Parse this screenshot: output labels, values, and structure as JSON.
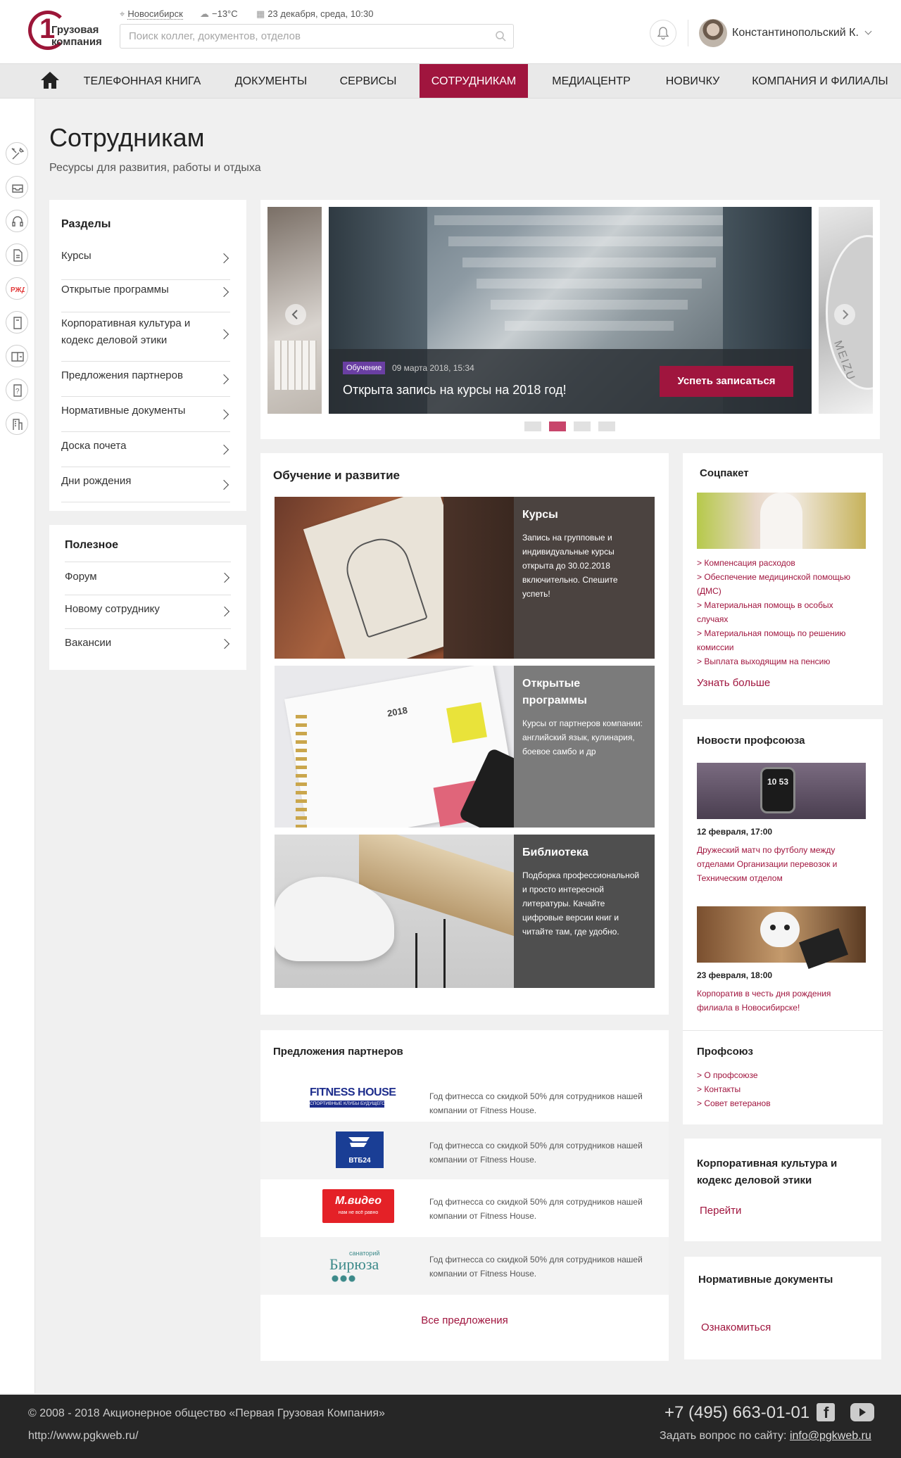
{
  "header": {
    "logo_line1": "Грузовая",
    "logo_line2": "компания",
    "city": "Новосибирск",
    "weather": "−13°C",
    "date": "23 декабря, среда, 10:30",
    "search_placeholder": "Поиск коллег, документов, отделов",
    "user_name": "Константинопольский К."
  },
  "nav": {
    "items": [
      "Телефонная книга",
      "Документы",
      "Сервисы",
      "Сотрудникам",
      "Медиацентр",
      "Новичку",
      "Компания и филиалы"
    ],
    "active_index": 3
  },
  "page": {
    "title": "Сотрудникам",
    "subtitle": "Ресурсы для развития, работы и отдыха"
  },
  "sections": {
    "heading": "Разделы",
    "items": [
      "Курсы",
      "Открытые программы",
      "Корпоративная культура и кодекс деловой этики",
      "Предложения партнеров",
      "Нормативные документы",
      "Доска почета",
      "Дни рождения"
    ]
  },
  "useful": {
    "heading": "Полезное",
    "items": [
      "Форум",
      "Новому сотруднику",
      "Вакансии"
    ]
  },
  "slider": {
    "tag": "Обучение",
    "date": "09 марта 2018, 15:34",
    "title": "Открыта запись на курсы на 2018 год!",
    "button": "Успеть записаться",
    "active_dot": 1,
    "dots_count": 4,
    "side_brand": "MEIZU"
  },
  "learning": {
    "heading": "Обучение и развитие",
    "cards": [
      {
        "title": "Курсы",
        "text": "Запись на групповые и индивидуальные курсы открыта до 30.02.2018 включительно. Спешите успеть!"
      },
      {
        "title": "Открытые программы",
        "text": "Курсы от партнеров компании: английский язык, кулинария, боевое самбо и др"
      },
      {
        "title": "Библиотека",
        "text": "Подборка профессиональной и просто интересной литературы. Качайте цифровые версии книг и читайте там, где удобно."
      }
    ],
    "calendar_year": "2018"
  },
  "partners": {
    "heading": "Предложения партнеров",
    "rows": [
      {
        "brand": "FITNESS HOUSE",
        "brand_sub": "СПОРТИВНЫЕ КЛУБЫ БУДУЩЕГО",
        "text": "Год фитнесса со скидкой 50% для сотрудников нашей компании от Fitness House."
      },
      {
        "brand": "ВТБ24",
        "brand_sub": "",
        "text": "Год фитнесса со скидкой 50% для сотрудников нашей компании от Fitness House."
      },
      {
        "brand": "М.видео",
        "brand_sub": "нам не всё равно",
        "text": "Год фитнесса со скидкой 50% для сотрудников нашей компании от Fitness House."
      },
      {
        "brand": "Бирюза",
        "brand_sub": "санаторий",
        "text": "Год фитнесса со скидкой 50% для сотрудников нашей компании от Fitness House."
      }
    ],
    "all_link": "Все предложения"
  },
  "social": {
    "heading": "Соцпакет",
    "links": [
      "> Компенсация расходов",
      "> Обеспечение медицинской помощью (ДМС)",
      "> Материальная помощь в особых случаях",
      "> Материальная помощь по решению комиссии",
      "> Выплата выходящим на пенсию"
    ],
    "more": "Узнать больше"
  },
  "union_news": {
    "heading": "Новости профсоюза",
    "items": [
      {
        "date": "12 февраля, 17:00",
        "title": "Дружеский матч по футболу между отделами Организации перевозок и Техническим отделом",
        "watch_digits": "10 53"
      },
      {
        "date": "23 февраля, 18:00",
        "title": "Корпоратив в честь дня рождения филиала в Новосибирске!"
      }
    ]
  },
  "union": {
    "heading": "Профсоюз",
    "links": [
      "> О профсоюзе",
      "> Контакты",
      "> Совет ветеранов"
    ]
  },
  "culture": {
    "heading": "Корпоративная культура и кодекс деловой этики",
    "link": "Перейти"
  },
  "norms": {
    "heading": "Нормативные документы",
    "link": "Ознакомиться"
  },
  "footer": {
    "copyright": "© 2008 - 2018 Акционерное общество «Первая Грузовая Компания»",
    "url": "http://www.pgkweb.ru/",
    "phone": "+7 (495) 663-01-01",
    "ask_label": "Задать вопрос по сайту:",
    "email": "info@pgkweb.ru"
  },
  "colors": {
    "accent": "#a0153e",
    "tag": "#6a3fa3",
    "footer": "#262626"
  }
}
